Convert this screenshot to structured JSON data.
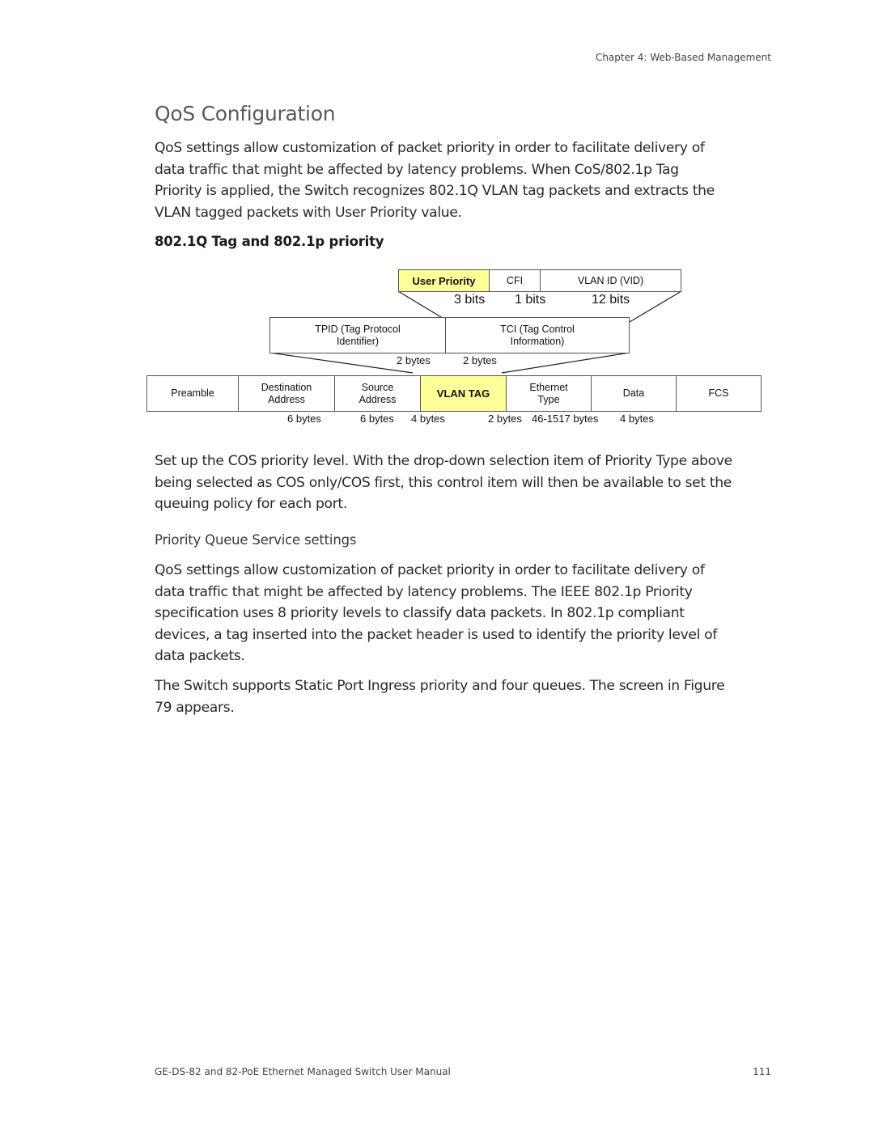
{
  "header": {
    "chapter": "Chapter 4: Web-Based Management"
  },
  "title": "QoS Configuration",
  "intro_paragraph_lines": [
    "QoS settings allow customization of packet priority in order to facilitate delivery of",
    "data traffic that might be affected by latency problems. When CoS/802.1p Tag",
    "Priority is applied, the Switch recognizes 802.1Q VLAN tag packets and extracts the",
    "VLAN tagged packets with User Priority value."
  ],
  "subheading_tag": "802.1Q Tag and 802.1p priority",
  "diagram": {
    "tci_fields": [
      {
        "label": "User Priority",
        "size": "3 bits",
        "highlight": true
      },
      {
        "label": "CFI",
        "size": "1 bits",
        "highlight": false
      },
      {
        "label": "VLAN ID (VID)",
        "size": "12 bits",
        "highlight": false
      }
    ],
    "tag_fields": [
      {
        "label_line1": "TPID (Tag Protocol",
        "label_line2": "Identifier)",
        "size": "2 bytes"
      },
      {
        "label_line1": "TCI (Tag Control",
        "label_line2": "Information)",
        "size": "2 bytes"
      }
    ],
    "frame_fields": [
      {
        "label_line1": "Preamble",
        "label_line2": "",
        "size": "",
        "highlight": false
      },
      {
        "label_line1": "Destination",
        "label_line2": "Address",
        "size": "6 bytes",
        "highlight": false
      },
      {
        "label_line1": "Source",
        "label_line2": "Address",
        "size": "6 bytes",
        "highlight": false
      },
      {
        "label_line1": "VLAN TAG",
        "label_line2": "",
        "size": "4 bytes",
        "highlight": true
      },
      {
        "label_line1": "Ethernet",
        "label_line2": "Type",
        "size": "2 bytes",
        "highlight": false
      },
      {
        "label_line1": "Data",
        "label_line2": "",
        "size": "46-1517 bytes",
        "highlight": false
      },
      {
        "label_line1": "FCS",
        "label_line2": "",
        "size": "4 bytes",
        "highlight": false
      }
    ],
    "highlight_color": "#ffff99"
  },
  "cos_paragraph_lines": [
    "Set up the COS priority level. With the drop-down selection item of Priority Type above",
    "being selected as COS only/COS first, this control item will then be available to set the",
    "queuing policy for each port."
  ],
  "subheading_queue": "Priority Queue Service settings",
  "queue_paragraph_lines": [
    "QoS settings allow customization of packet priority in order to facilitate delivery of",
    "data traffic that might be affected by latency problems. The IEEE 802.1p Priority",
    "specification uses 8 priority levels to classify data packets. In 802.1p compliant",
    "devices, a tag inserted into the packet header is used to identify the priority level of",
    "data packets."
  ],
  "switch_paragraph_lines": [
    "The Switch supports Static Port Ingress priority and four queues. The screen in Figure",
    "79 appears."
  ],
  "footer": {
    "manual_title": "GE-DS-82 and 82-PoE Ethernet Managed Switch User Manual",
    "page_number": "111"
  }
}
